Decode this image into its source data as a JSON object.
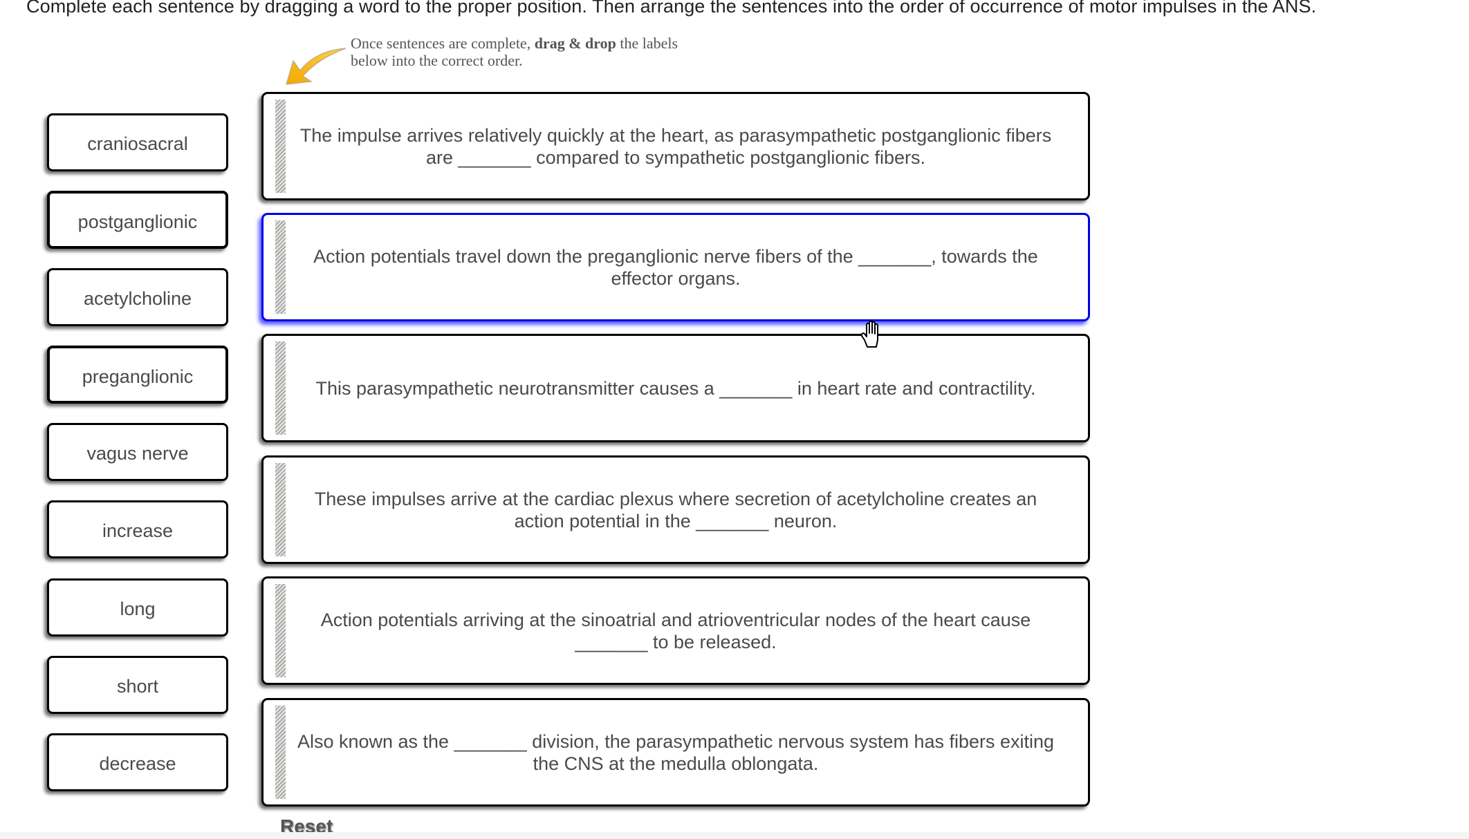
{
  "instructions": {
    "heading": "Complete each sentence by dragging a word to the proper position. Then arrange the sentences into the order of occurrence of motor impulses in the ANS.",
    "hint_prefix": "Once sentences are complete, ",
    "hint_bold": "drag & drop",
    "hint_suffix": " the labels below into the correct order."
  },
  "word_bank": [
    {
      "label": "craniosacral"
    },
    {
      "label": "postganglionic"
    },
    {
      "label": "acetylcholine"
    },
    {
      "label": "preganglionic"
    },
    {
      "label": "vagus nerve"
    },
    {
      "label": "increase"
    },
    {
      "label": "long"
    },
    {
      "label": "short"
    },
    {
      "label": "decrease"
    }
  ],
  "sentences": [
    {
      "text": "The impulse arrives relatively quickly at the heart, as parasympathetic postganglionic fibers are _______ compared to sympathetic postganglionic fibers.",
      "selected": false
    },
    {
      "text": "Action potentials travel down the preganglionic nerve fibers of the _______, towards the effector organs.",
      "selected": true
    },
    {
      "text": "This parasympathetic neurotransmitter causes a _______ in heart rate and contractility.",
      "selected": false
    },
    {
      "text": "These impulses arrive at the cardiac plexus where secretion of acetylcholine creates an action potential in the _______ neuron.",
      "selected": false
    },
    {
      "text": "Action potentials arriving at the sinoatrial and atrioventricular nodes of the heart cause _______ to be released.",
      "selected": false
    },
    {
      "text": "Also known as the _______ division, the parasympathetic nervous system has fibers exiting the CNS at the medulla oblongata.",
      "selected": false
    }
  ],
  "controls": {
    "reset_label": "Reset"
  },
  "colors": {
    "selected_border": "#0000e6",
    "arrow": "#f5b400"
  },
  "icons": {
    "hint_arrow": "curved-arrow-down-left",
    "cursor": "hand-pointer",
    "drag_handle": "striped-grip"
  }
}
